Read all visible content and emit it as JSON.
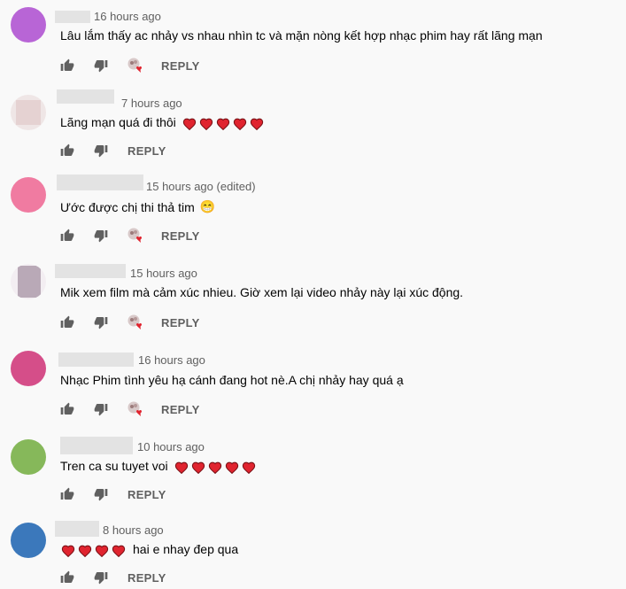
{
  "colors": {
    "heart": "#e0242f",
    "text": "#030303",
    "muted": "#606060"
  },
  "comments": [
    {
      "time": "16 hours ago",
      "text": "Lâu lắm thấy ac nhảy vs nhau nhìn tc và mặn nòng kết hợp nhạc phim hay rất lãng mạn",
      "hearts_before": 0,
      "hearts_after": 0,
      "emoji": "",
      "creator_heart": true,
      "reply": "REPLY",
      "avatar_color": "#b865d6"
    },
    {
      "time": "7 hours ago",
      "text": "Lãng mạn quá đi thôi",
      "hearts_before": 0,
      "hearts_after": 5,
      "emoji": "",
      "creator_heart": false,
      "reply": "REPLY",
      "avatar_color": "#ecdada"
    },
    {
      "time": "15 hours ago (edited)",
      "text": "Ước được chị thi thả tim",
      "hearts_before": 0,
      "hearts_after": 0,
      "emoji": "😁",
      "creator_heart": true,
      "reply": "REPLY",
      "avatar_color": "#f07ba1"
    },
    {
      "time": "15 hours ago",
      "text": "Mik xem film mà cảm xúc nhieu. Giờ xem lại video nhảy này lại xúc động.",
      "hearts_before": 0,
      "hearts_after": 0,
      "emoji": "",
      "creator_heart": true,
      "reply": "REPLY",
      "avatar_color": "#b9a9b7"
    },
    {
      "time": "16 hours ago",
      "text": "Nhạc Phim tình yêu hạ cánh đang hot nè.A chị nhảy hay quá ạ",
      "hearts_before": 0,
      "hearts_after": 0,
      "emoji": "",
      "creator_heart": true,
      "reply": "REPLY",
      "avatar_color": "#d54e89"
    },
    {
      "time": "10 hours ago",
      "text": "Tren ca su tuyet voi",
      "hearts_before": 0,
      "hearts_after": 5,
      "emoji": "",
      "creator_heart": false,
      "reply": "REPLY",
      "avatar_color": "#86b85a"
    },
    {
      "time": "8 hours ago",
      "text": "hai e nhay đep qua",
      "hearts_before": 4,
      "hearts_after": 0,
      "emoji": "",
      "creator_heart": false,
      "reply": "REPLY",
      "avatar_color": "#3b78bb"
    }
  ]
}
